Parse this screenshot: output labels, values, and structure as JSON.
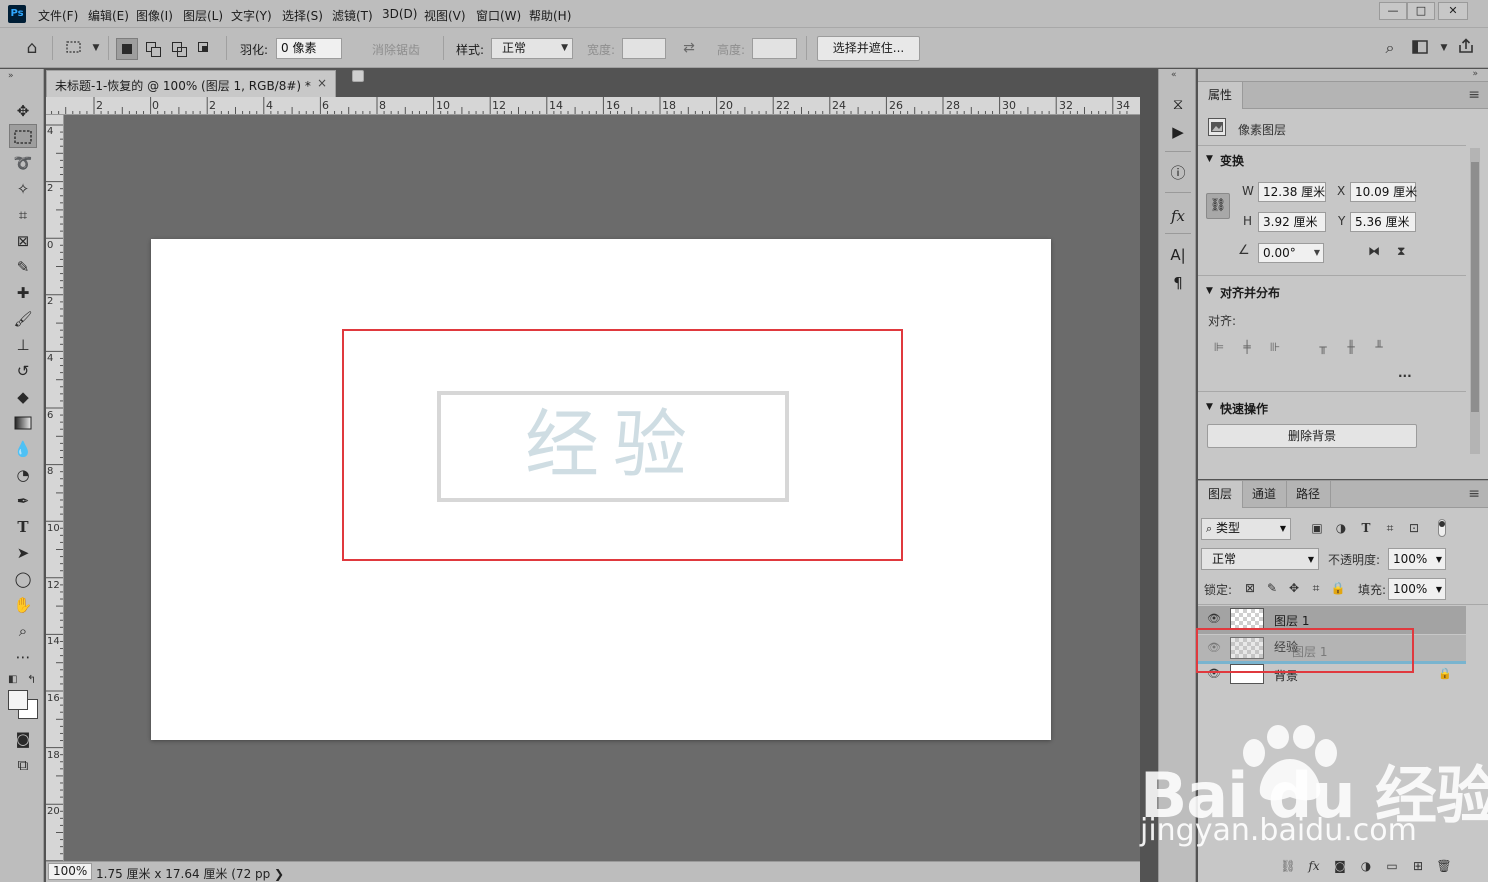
{
  "menubar": {
    "items": [
      "文件(F)",
      "编辑(E)",
      "图像(I)",
      "图层(L)",
      "文字(Y)",
      "选择(S)",
      "滤镜(T)",
      "3D(D)",
      "视图(V)",
      "窗口(W)",
      "帮助(H)"
    ],
    "logo": "Ps",
    "window_buttons": [
      "—",
      "□",
      "✕"
    ]
  },
  "options": {
    "feather_label": "羽化:",
    "feather_value": "0 像素",
    "antialias_label": "消除锯齿",
    "style_label": "样式:",
    "style_value": "正常",
    "width_label": "宽度:",
    "height_label": "高度:",
    "select_mask_button": "选择并遮住..."
  },
  "document": {
    "tab_title": "未标题-1-恢复的 @ 100% (图层 1, RGB/8#) *",
    "close": "×",
    "ruler_h": [
      "2",
      "0",
      "2",
      "4",
      "6",
      "8",
      "10",
      "12",
      "14",
      "16",
      "18",
      "20",
      "22",
      "24",
      "26",
      "28",
      "30",
      "32",
      "34"
    ],
    "ruler_v": [
      "4",
      "2",
      "0",
      "2",
      "4",
      "6",
      "8",
      "10",
      "12",
      "14",
      "16",
      "18",
      "20"
    ],
    "canvas_text": "经验",
    "zoom": "100%",
    "status_info": "1.75 厘米 x 17.64 厘米 (72 pp ❯"
  },
  "properties": {
    "tab": "属性",
    "layer_type": "像素图层",
    "transform_title": "变换",
    "w_label": "W",
    "w_value": "12.38 厘米",
    "x_label": "X",
    "x_value": "10.09 厘米",
    "h_label": "H",
    "h_value": "3.92 厘米",
    "y_label": "Y",
    "y_value": "5.36 厘米",
    "angle_value": "0.00°",
    "align_title": "对齐并分布",
    "align_label": "对齐:",
    "more": "...",
    "quick_title": "快速操作",
    "remove_bg": "删除背景"
  },
  "layers": {
    "tabs": [
      "图层",
      "通道",
      "路径"
    ],
    "filter_value": "类型",
    "blend_mode": "正常",
    "opacity_label": "不透明度:",
    "opacity_value": "100%",
    "lock_label": "锁定:",
    "fill_label": "填充:",
    "fill_value": "100%",
    "rows": [
      {
        "name": "图层 1"
      },
      {
        "name": "经验",
        "ghost": "图层 1"
      },
      {
        "name": "背景"
      }
    ]
  },
  "watermark": {
    "brand": "Bai du 经验",
    "url": "jingyan.baidu.com"
  },
  "colors": {
    "accent_red": "#e0393e",
    "ps_blue": "#31a8ff",
    "panel_bg": "#c7c7c7",
    "pasteboard": "#6b6b6b"
  }
}
